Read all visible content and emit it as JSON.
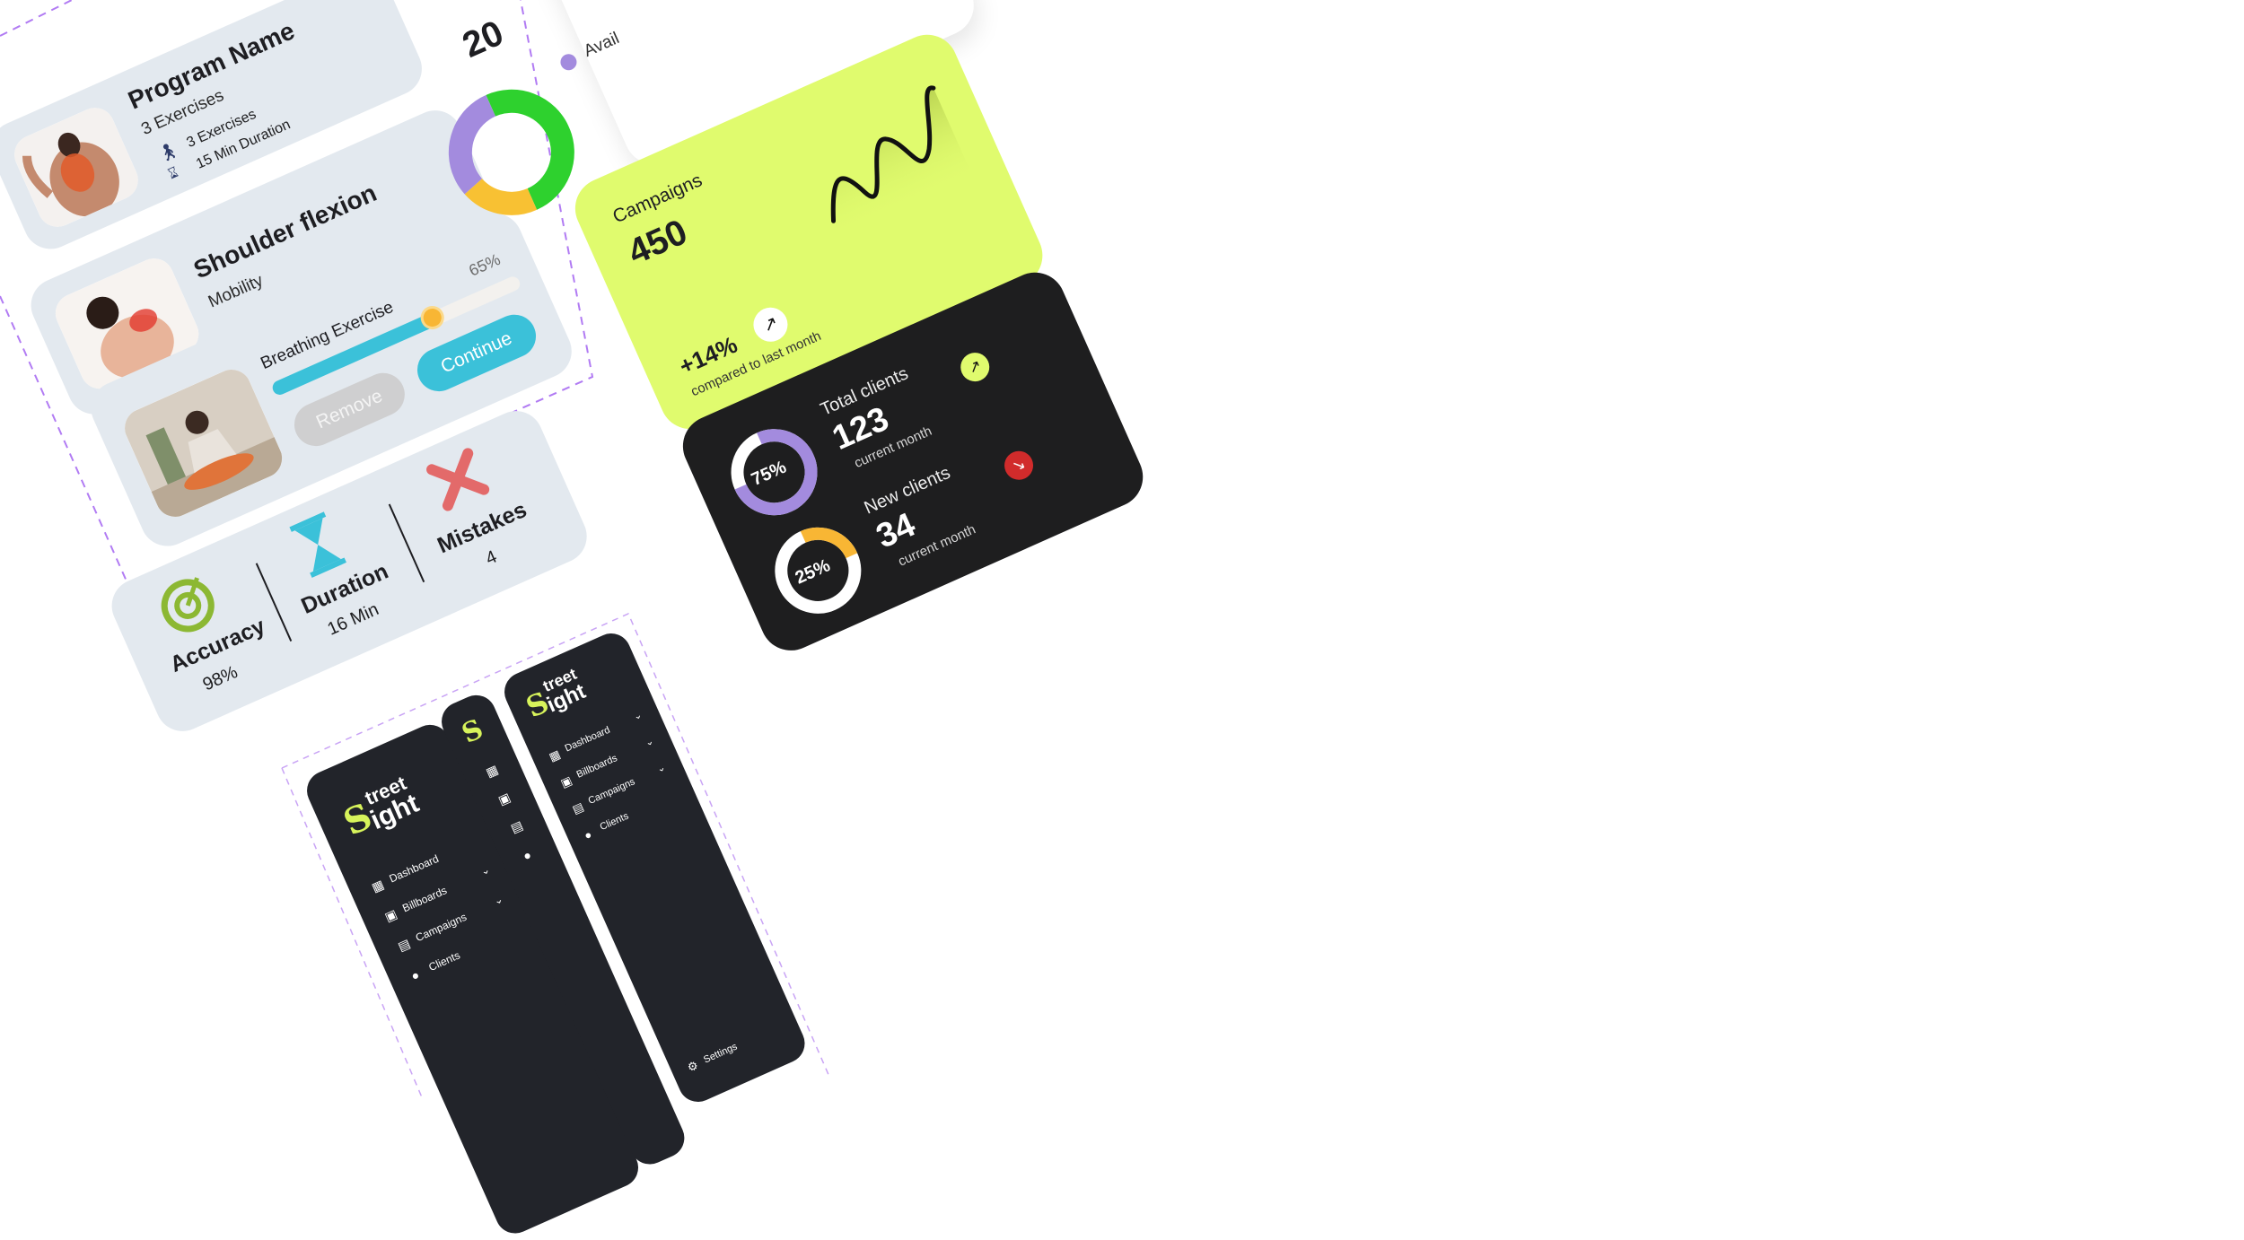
{
  "program_card": {
    "title": "Program Name",
    "subtitle": "3 Exercises",
    "meta_exercises": "3 Exercises",
    "meta_duration": "15 Min Duration"
  },
  "exercise_card": {
    "title": "Shoulder flexion",
    "category": "Mobility"
  },
  "progress_card": {
    "title": "Breathing Exercise",
    "progress": 0.65,
    "percent_label": "65%",
    "remove_label": "Remove",
    "continue_label": "Continue"
  },
  "stats_card": {
    "accuracy_label": "Accuracy",
    "accuracy_value": "98%",
    "duration_label": "Duration",
    "duration_value": "16 Min",
    "mistakes_label": "Mistakes",
    "mistakes_value": "4"
  },
  "availability_card": {
    "number_partial": "20",
    "legend_label": "Avail",
    "legend_color": "#a38bde",
    "donut_segments": [
      {
        "color": "#2ed12e",
        "fraction": 0.5
      },
      {
        "color": "#f8c133",
        "fraction": 0.2
      },
      {
        "color": "#a38bde",
        "fraction": 0.3
      }
    ]
  },
  "campaigns_card": {
    "title": "Campaigns",
    "value": "450",
    "change": "+14%",
    "change_caption": "compared to last month",
    "background": "#e0fb6e"
  },
  "clients_card": {
    "background": "#1e1e1f",
    "total": {
      "percent_label": "75%",
      "progress": 0.75,
      "title": "Total clients",
      "value": "123",
      "caption": "current month",
      "ring_color": "#a38bde",
      "badge_color": "#e0fb6e"
    },
    "new": {
      "percent_label": "25%",
      "progress": 0.25,
      "title": "New clients",
      "value": "34",
      "caption": "current month",
      "ring_color": "#f8b634",
      "badge_color": "#d12b2b"
    }
  },
  "sidebars": {
    "logo_line1": "treet",
    "logo_line2": "ight",
    "accent": "#d7f35b",
    "items": [
      {
        "label": "Dashboard",
        "icon": "dashboard-icon"
      },
      {
        "label": "Billboards",
        "icon": "billboard-icon"
      },
      {
        "label": "Campaigns",
        "icon": "campaign-icon"
      },
      {
        "label": "Clients",
        "icon": "clients-icon"
      }
    ],
    "settings_label": "Settings"
  }
}
